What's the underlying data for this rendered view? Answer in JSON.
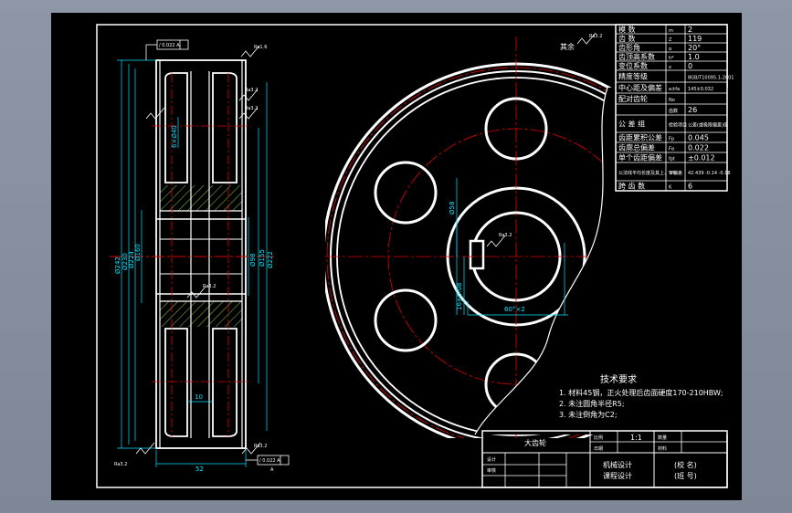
{
  "colors": {
    "background": "#000000",
    "line": "#ffffff",
    "dimension": "#00e5ff",
    "centerline": "#e00000",
    "hatch": "#7fd13b"
  },
  "roughness": {
    "rest": "其余",
    "all_symbol": "Ra3.2",
    "tags": [
      "Ra1.6",
      "Ra3.2",
      "Ra3.2",
      "Ra3.2",
      "Ra3.2",
      "Ra3.2",
      "Ra3.2"
    ]
  },
  "tolerance": {
    "top": "/ 0.022 A",
    "bottom": "/ 0.022 A",
    "datum": "A"
  },
  "section_dims": {
    "vertical": [
      "Ø242",
      "Ø230",
      "Ø224",
      "Ø160",
      "Ø58",
      "Ø98",
      "Ø155",
      "Ø222"
    ],
    "width": "52",
    "hole": "6×Ø40",
    "rim": "10",
    "bore": "Ø58"
  },
  "keyway": {
    "depth": "16±0.08",
    "angle": "60°×2"
  },
  "spec_table": [
    {
      "name": "模 数",
      "sym": "m",
      "val": "2"
    },
    {
      "name": "齿 数",
      "sym": "Z",
      "val": "119"
    },
    {
      "name": "齿形角",
      "sym": "α",
      "val": "20°"
    },
    {
      "name": "齿顶高系数",
      "sym": "h*",
      "val": "1.0"
    },
    {
      "name": "变位系数",
      "sym": "x",
      "val": "0"
    },
    {
      "name": "精度等级",
      "sym": "",
      "val": "8GB/T10095.1-2001"
    },
    {
      "name": "中心距及偏差",
      "sym": "a±fa",
      "val": "145±0.032"
    },
    {
      "name": "配对齿轮",
      "sym": "No",
      "val": ""
    },
    {
      "name": "",
      "sym": "齿数",
      "val": "26"
    },
    {
      "name": "公 差 组",
      "sym": "检验项目",
      "val": "公差(或极限偏差)值"
    },
    {
      "name": "齿距累积公差",
      "sym": "Fp",
      "val": "0.045"
    },
    {
      "name": "齿廓总偏差",
      "sym": "Fα",
      "val": "0.022"
    },
    {
      "name": "单个齿距偏差",
      "sym": "fpt",
      "val": "±0.012"
    },
    {
      "name": "公法线平均长度及其上、下偏差",
      "sym": "Wk",
      "val": "42.439 -0.14 -0.18"
    },
    {
      "name": "跨 齿 数",
      "sym": "K",
      "val": "6"
    }
  ],
  "tech_req": {
    "title": "技术要求",
    "lines": [
      "1. 材料45钢，正火处理后齿面硬度170-210HBW;",
      "2. 未注圆角半径R5;",
      "3. 未注倒角为C2;"
    ]
  },
  "title_block": {
    "part": "大齿轮",
    "ratio_label": "比例",
    "ratio": "1:1",
    "qty_label": "数量",
    "material_label": "材料",
    "drawn": "设计",
    "checked": "审核",
    "date": "日期",
    "course1": "机械设计",
    "course2": "课程设计",
    "school": "(校 名)",
    "class": "(班 号)"
  }
}
